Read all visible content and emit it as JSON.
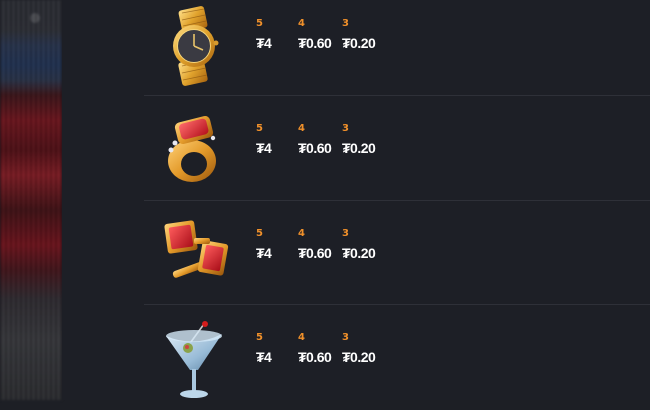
{
  "paytable": {
    "rows": [
      {
        "symbol_icon": "gold-watch-icon",
        "pays": [
          {
            "count": "5",
            "amount": "₮4"
          },
          {
            "count": "4",
            "amount": "₮0.60"
          },
          {
            "count": "3",
            "amount": "₮0.20"
          }
        ]
      },
      {
        "symbol_icon": "ruby-ring-icon",
        "pays": [
          {
            "count": "5",
            "amount": "₮4"
          },
          {
            "count": "4",
            "amount": "₮0.60"
          },
          {
            "count": "3",
            "amount": "₮0.20"
          }
        ]
      },
      {
        "symbol_icon": "cufflinks-icon",
        "pays": [
          {
            "count": "5",
            "amount": "₮4"
          },
          {
            "count": "4",
            "amount": "₮0.60"
          },
          {
            "count": "3",
            "amount": "₮0.20"
          }
        ]
      },
      {
        "symbol_icon": "martini-glass-icon",
        "pays": [
          {
            "count": "5",
            "amount": "₮4"
          },
          {
            "count": "4",
            "amount": "₮0.60"
          },
          {
            "count": "3",
            "amount": "₮0.20"
          }
        ]
      }
    ]
  },
  "colors": {
    "background": "#1d1f26",
    "count_accent": "#f0902a",
    "amount_text": "#ffffff",
    "divider": "#2e3038"
  }
}
